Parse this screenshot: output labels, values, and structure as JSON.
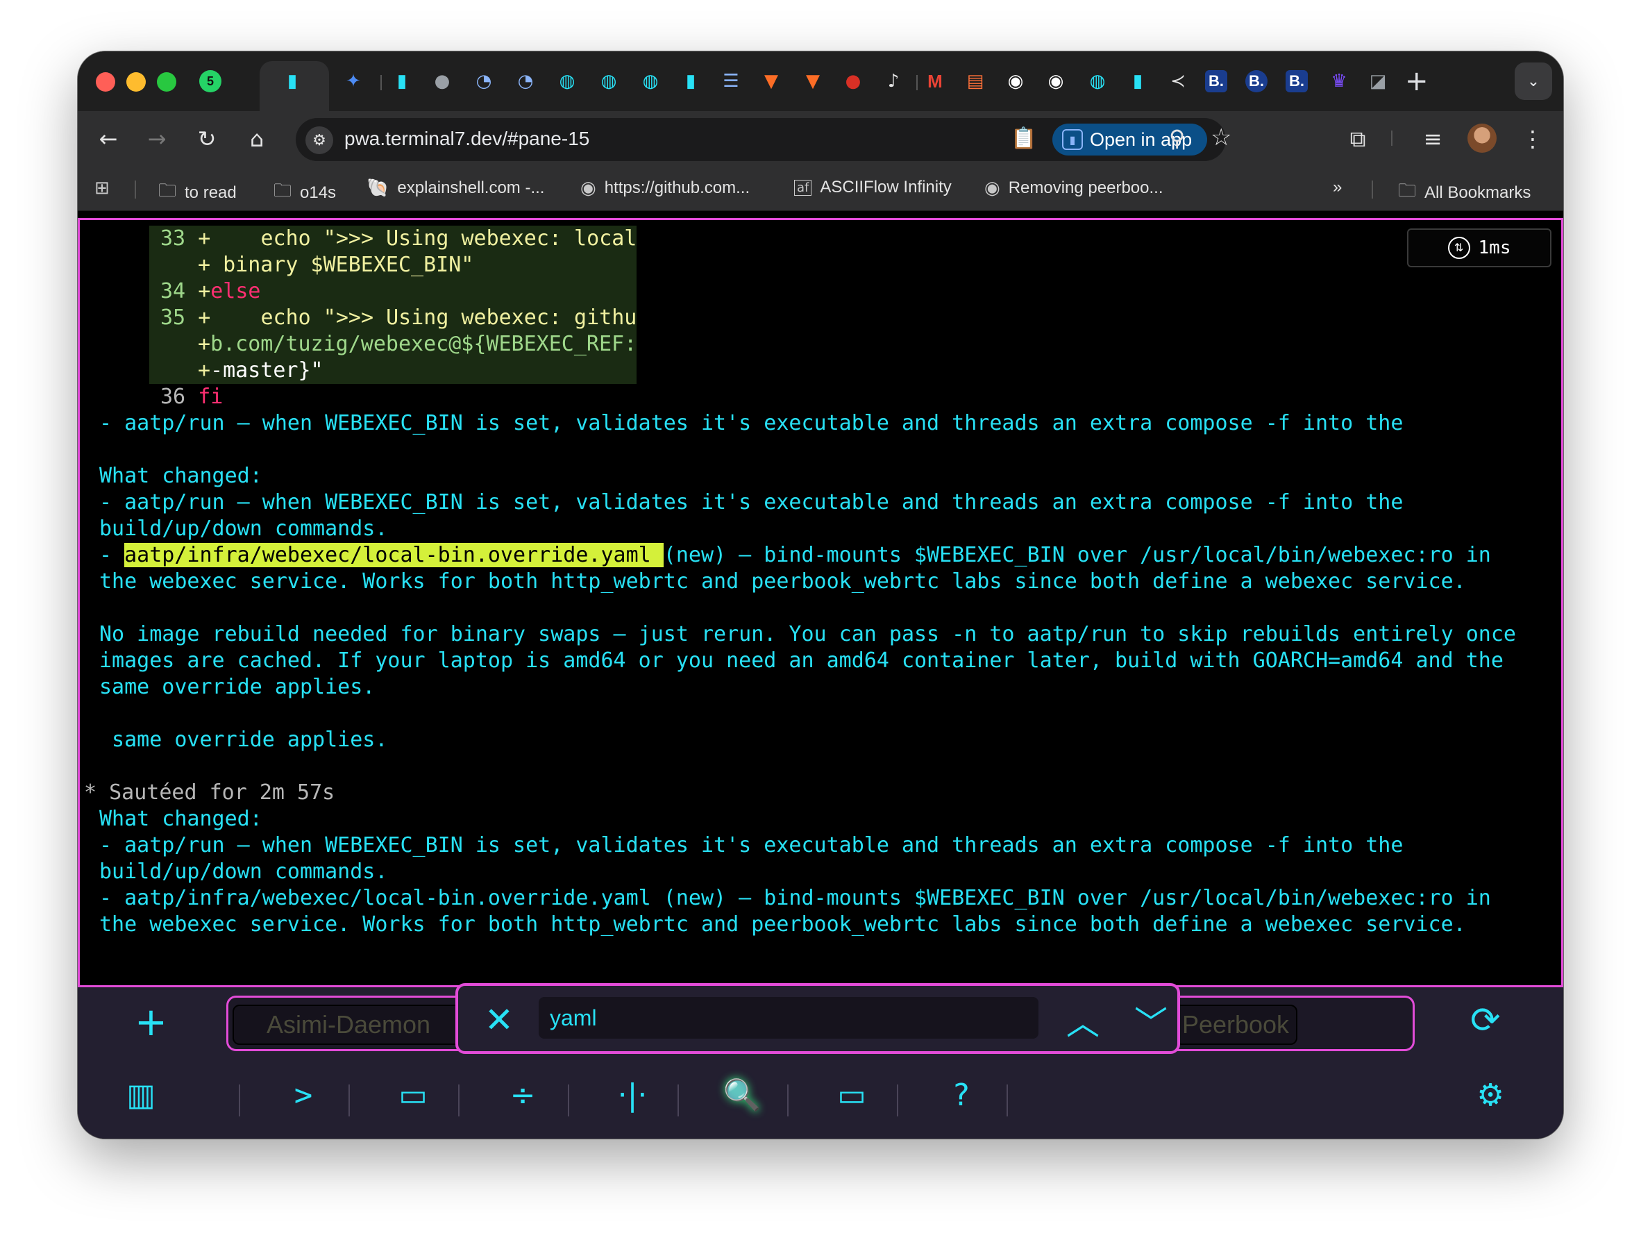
{
  "browser": {
    "url": "pwa.terminal7.dev/#pane-15",
    "open_in_app_label": "Open in app",
    "tab_badge": "5",
    "tab_icons": [
      "terminal7-icon",
      "gemini-icon",
      "terminal7-icon",
      "apple-icon",
      "loader-icon",
      "loader-icon",
      "terminal7-icon",
      "terminal7-icon",
      "terminal7-icon",
      "terminal7-icon",
      "list-icon",
      "gitlab-icon",
      "gitlab-icon",
      "record-icon",
      "speaker-icon",
      "gmail-icon",
      "bookmark-icon",
      "github-icon",
      "github-icon",
      "terminal7-icon",
      "terminal7-icon",
      "share-icon",
      "b-icon",
      "b-icon",
      "b-icon",
      "crown-icon",
      "chart-icon"
    ]
  },
  "bookmarks": [
    {
      "label": "to read",
      "icon": "folder-icon"
    },
    {
      "label": "o14s",
      "icon": "folder-icon"
    },
    {
      "label": "explainshell.com -...",
      "icon": "shell-icon"
    },
    {
      "label": "https://github.com...",
      "icon": "github-icon"
    },
    {
      "label": "ASCIIFlow Infinity",
      "icon": "asciiflow-icon"
    },
    {
      "label": "Removing peerboo...",
      "icon": "github-icon"
    }
  ],
  "bookmarks_more": "»",
  "all_bookmarks": "All Bookmarks",
  "terminal": {
    "latency": "1ms",
    "diff": {
      "l1_num": "33",
      "l1_text": "+    echo \">>> Using webexec: local",
      "l2_text": "+ binary $WEBEXEC_BIN\"",
      "l3_num": "34",
      "l3_plus": "+",
      "l3_kw": "else",
      "l4_num": "35",
      "l4_text": "+    echo \">>> Using webexec: githu",
      "l5_plus": "+",
      "l5_text": "b.com/tuzig/webexec@${WEBEXEC_REF:",
      "l6_plus": "+",
      "l6_text": "-master}\"",
      "l7_num": "36",
      "l7_kw": "fi"
    },
    "lines": {
      "a1": "- aatp/run — when WEBEXEC_BIN is set, validates it's executable and threads an extra compose -f into the",
      "a2": "What changed:",
      "a3": "- aatp/run — when WEBEXEC_BIN is set, validates it's executable and threads an extra compose -f into the",
      "a4": "build/up/down commands.",
      "a5_dash": "- ",
      "a5_hl": "aatp/infra/webexec/local-bin.override.yaml ",
      "a5_rest": "(new) — bind-mounts $WEBEXEC_BIN over /usr/local/bin/webexec:ro in",
      "a6": "the webexec service. Works for both http_webrtc and peerbook_webrtc labs since both define a webexec service.",
      "a7": "No image rebuild needed for binary swaps — just rerun. You can pass -n to aatp/run to skip rebuilds entirely once",
      "a8": "images are cached. If your laptop is amd64 or you need an amd64 container later, build with GOARCH=amd64 and the",
      "a9": "same override applies.",
      "a10": " same override applies.",
      "a11_star": "*",
      "a11": "Sautéed for 2m 57s",
      "a12": "What changed:",
      "a13": "- aatp/run — when WEBEXEC_BIN is set, validates it's executable and threads an extra compose -f into the",
      "a14": "build/up/down commands.",
      "a15": "- aatp/infra/webexec/local-bin.override.yaml (new) — bind-mounts $WEBEXEC_BIN over /usr/local/bin/webexec:ro in",
      "a16": "the webexec service. Works for both http_webrtc and peerbook_webrtc labs since both define a webexec service."
    }
  },
  "bottom": {
    "tabs": [
      "Asimi-Daemon",
      "Peerbook"
    ],
    "search_value": "yaml",
    "tools": [
      "map-icon",
      "prompt-icon",
      "cast-icon",
      "divide-horizontal-icon",
      "divide-vertical-icon",
      "search-log-icon",
      "video-icon",
      "help-icon",
      "settings-icon"
    ]
  },
  "colors": {
    "accent": "#e24cd8",
    "terminal_text": "#28e1f5",
    "highlight": "#d4f03a"
  }
}
